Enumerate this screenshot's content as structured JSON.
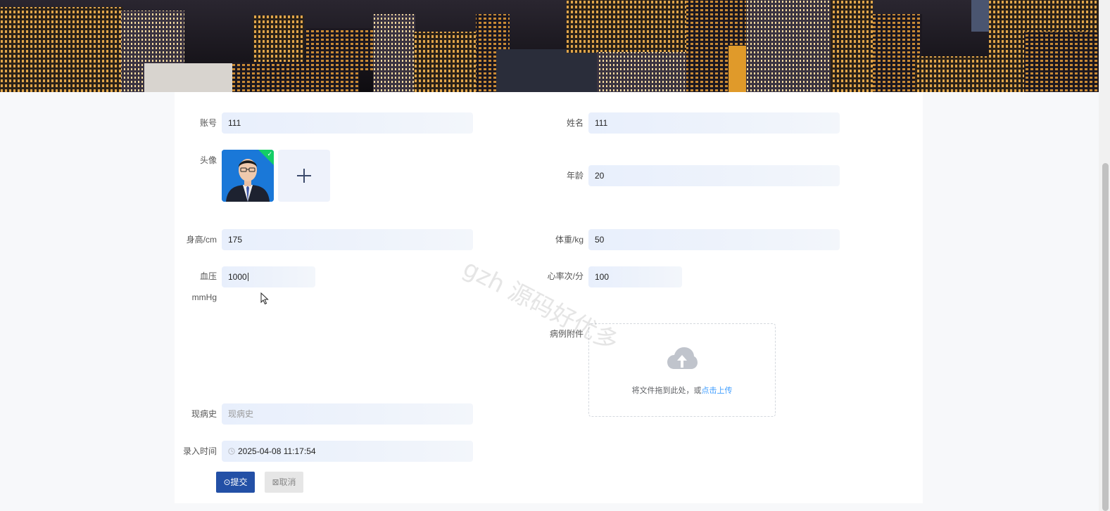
{
  "form": {
    "account": {
      "label": "账号",
      "value": "111"
    },
    "name": {
      "label": "姓名",
      "value": "111"
    },
    "avatar": {
      "label": "头像"
    },
    "age": {
      "label": "年龄",
      "value": "20"
    },
    "height": {
      "label": "身高/cm",
      "value": "175"
    },
    "weight": {
      "label": "体重/kg",
      "value": "50"
    },
    "blood_pressure": {
      "label": "血压",
      "unit": "mmHg",
      "value": "1000"
    },
    "heart_rate": {
      "label": "心率次/分",
      "value": "100"
    },
    "attachment": {
      "label": "病例附件",
      "drop_text": "将文件拖到此处，或",
      "link_text": "点击上传"
    },
    "history": {
      "label": "现病史",
      "placeholder": "现病史"
    },
    "record_time": {
      "label": "录入时间",
      "value": "2025-04-08 11:17:54"
    }
  },
  "buttons": {
    "submit": "⊙提交",
    "cancel": "⊠取消"
  },
  "watermark": "gzh 源码好优多",
  "colors": {
    "primary": "#2350a6",
    "field_bg": "#e8effc",
    "success": "#13ce66",
    "link": "#409eff"
  }
}
